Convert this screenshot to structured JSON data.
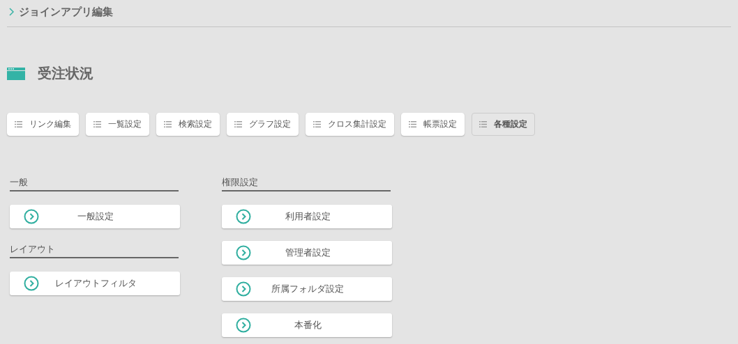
{
  "breadcrumb": {
    "label": "ジョインアプリ編集"
  },
  "page_title": "受注状況",
  "tabs": [
    {
      "label": "リンク編集",
      "selected": false
    },
    {
      "label": "一覧設定",
      "selected": false
    },
    {
      "label": "検索設定",
      "selected": false
    },
    {
      "label": "グラフ設定",
      "selected": false
    },
    {
      "label": "クロス集計設定",
      "selected": false
    },
    {
      "label": "帳票設定",
      "selected": false
    },
    {
      "label": "各種設定",
      "selected": true
    }
  ],
  "columns": [
    {
      "sections": [
        {
          "title": "一般",
          "items": [
            "一般設定"
          ]
        },
        {
          "title": "レイアウト",
          "items": [
            "レイアウトフィルタ"
          ]
        }
      ]
    },
    {
      "sections": [
        {
          "title": "権限設定",
          "items": [
            "利用者設定",
            "管理者設定",
            "所属フォルダ設定",
            "本番化"
          ]
        }
      ]
    }
  ]
}
